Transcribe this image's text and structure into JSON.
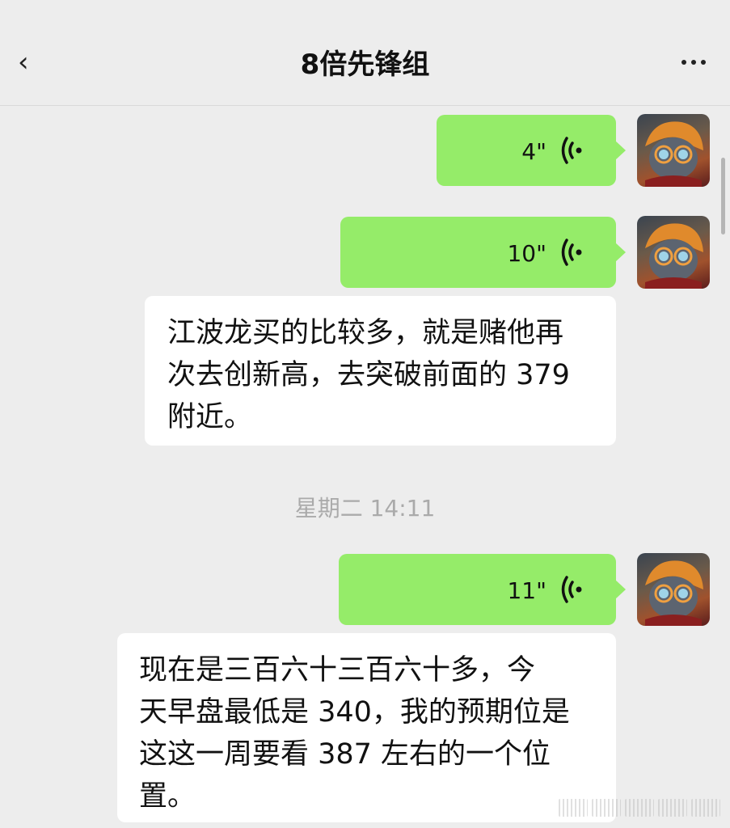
{
  "header": {
    "title": "8倍先锋组"
  },
  "messages": {
    "voice1": {
      "duration": "4\""
    },
    "voice2": {
      "duration": "10\""
    },
    "text1": {
      "lines": [
        "江波龙买的比较多，就是赌他再",
        "次去创新高，去突破前面的 379",
        "附近。"
      ]
    },
    "timestamp": "星期二 14:11",
    "voice3": {
      "duration": "11\""
    },
    "text2": {
      "lines": [
        "现在是三百六十三百六十多，今",
        "天早盘最低是 340，我的预期位是",
        "这这一周要看 387 左右的一个位",
        "置。"
      ]
    }
  },
  "colors": {
    "self_bubble": "#95ec69",
    "background": "#ededed",
    "text_bubble": "#ffffff"
  }
}
